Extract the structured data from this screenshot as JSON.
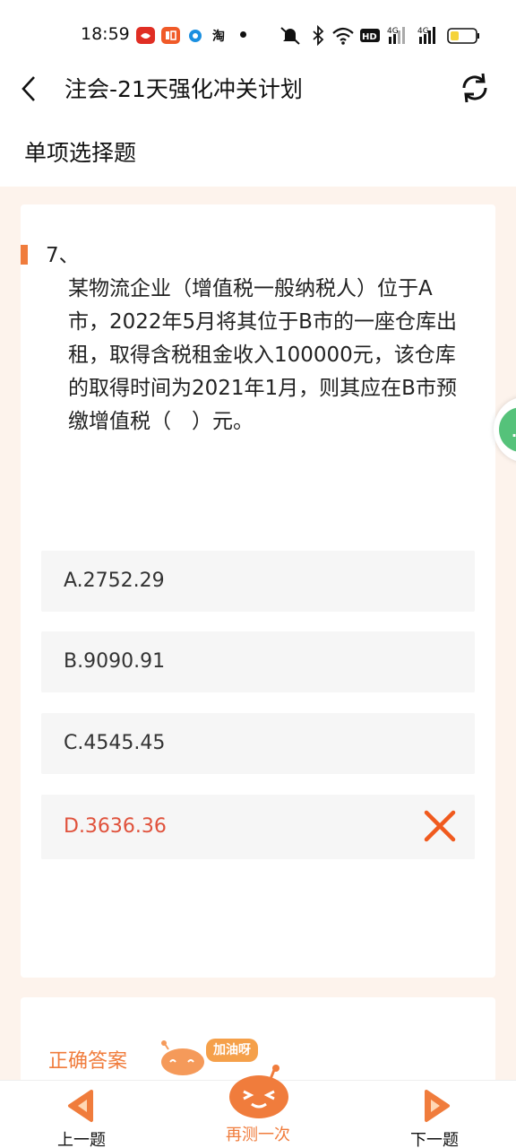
{
  "status_bar": {
    "time": "18:59",
    "app_icons": [
      "pinduoduo-icon",
      "ting-icon",
      "circle-app-icon",
      "taobao-icon"
    ],
    "network_badge": "HD",
    "signal_1": "4G",
    "signal_2": "4G",
    "battery_color": "#f5d33a"
  },
  "header": {
    "title": "注会-21天强化冲关计划"
  },
  "section_title": "单项选择题",
  "question": {
    "number": "7、",
    "text": "某物流企业（增值税一般纳税人）位于A市，2022年5月将其位于B市的一座仓库出租，取得含税租金收入100000元，该仓库的取得时间为2021年1月，则其应在B市预缴增值税（　）元。"
  },
  "options": [
    {
      "label": "A.2752.29",
      "state": "normal"
    },
    {
      "label": "B.9090.91",
      "state": "normal"
    },
    {
      "label": "C.4545.45",
      "state": "normal"
    },
    {
      "label": "D.3636.36",
      "state": "wrong"
    }
  ],
  "answer_section": {
    "title": "正确答案",
    "cheer_text": "加油呀"
  },
  "bottom_bar": {
    "prev_label": "上一题",
    "retry_label": "再测一次",
    "next_label": "下一题"
  },
  "colors": {
    "accent": "#f07c3c",
    "wrong": "#e0523c",
    "option_bg": "#f6f6f6",
    "panel_bg": "#fdf3ec",
    "side_tab": "#55c27a"
  }
}
